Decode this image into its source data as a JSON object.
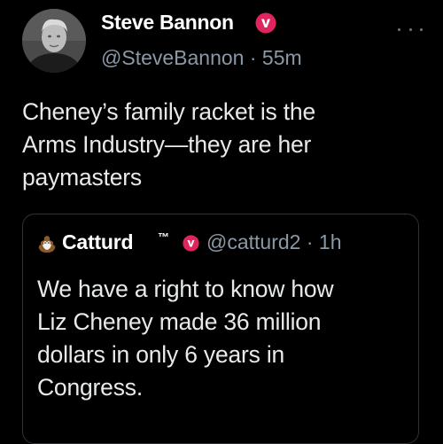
{
  "author": {
    "display_name": "Steve Bannon",
    "handle": "@SteveBannon",
    "separator": "·",
    "time": "55m",
    "avatar": "avatar-steve-bannon",
    "badge_icon": "verified-badge-icon",
    "badge_color": "#e0245e"
  },
  "tweet": {
    "text": "Cheney’s family racket is the\nArms Industry—they are her\npaymasters"
  },
  "more_icon": "ellipsis-icon",
  "quote": {
    "display_name": "Catturd",
    "tm": "™",
    "handle": "@catturd2",
    "separator": "·",
    "time": "1h",
    "avatar": "avatar-catturd",
    "badge_icon": "verified-badge-icon",
    "text": "We have a right to know how\nLiz Cheney made 36 million\ndollars in only 6 years in\nCongress."
  },
  "colors": {
    "background": "#000000",
    "text": "#e7e9ea",
    "secondary_text": "#8b98a5",
    "badge_red": "#e0245e",
    "border": "#2f3336"
  }
}
